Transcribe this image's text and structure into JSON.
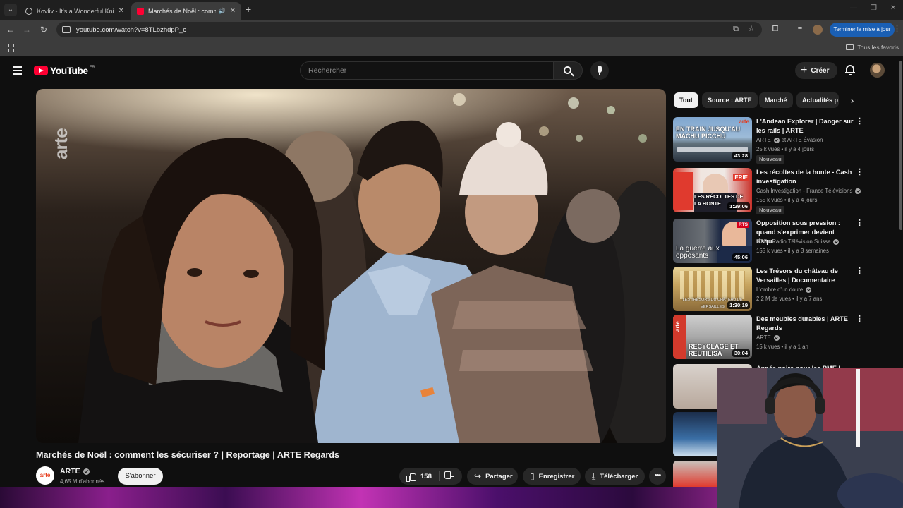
{
  "browser": {
    "tabs": [
      {
        "title": "Kovliv - It's a Wonderful Knife (",
        "active": false
      },
      {
        "title": "Marchés de Noël : commen",
        "active": true
      }
    ],
    "url": "youtube.com/watch?v=8TLbzhdpP_c",
    "update_label": "Terminer la mise à jour",
    "bookmarks_label": "Tous les favoris"
  },
  "youtube": {
    "logo_text": "YouTube",
    "country": "FR",
    "search_placeholder": "Rechercher",
    "create_label": "Créer"
  },
  "video": {
    "watermark": "arte",
    "title": "Marchés de Noël : comment les sécuriser ? | Reportage | ARTE Regards",
    "channel": "ARTE",
    "channel_avatar_text": "arte",
    "subscribers": "4,65 M d'abonnés",
    "subscribe_label": "S'abonner",
    "likes": "158",
    "share_label": "Partager",
    "save_label": "Enregistrer",
    "download_label": "Télécharger"
  },
  "chips": [
    "Tout",
    "Source : ARTE",
    "Marché",
    "Actualités p"
  ],
  "recommendations": [
    {
      "title": "L'Andean Explorer | Danger sur les rails | ARTE",
      "channel": "ARTE",
      "channel_suffix": "et ARTE Évasion",
      "meta": "25 k vues • il y a 4 jours",
      "badge": "Nouveau",
      "duration": "43:28",
      "thumb_caption": "EN TRAIN JUSQU'AU MACHU PICCHU",
      "thumb_logo": "arte"
    },
    {
      "title": "Les récoltes de la honte - Cash investigation",
      "channel": "Cash Investigation - France Télévisions",
      "channel_suffix": "",
      "meta": "155 k vues • il y a 4 jours",
      "badge": "Nouveau",
      "duration": "1:29:06",
      "thumb_caption": "LES RÉCOLTES DE LA HONTE",
      "thumb_logo": "ERIE"
    },
    {
      "title": "Opposition sous pression : quand s'exprimer devient risqu...",
      "channel": "RTS - Radio Télévision Suisse",
      "channel_suffix": "",
      "meta": "155 k vues • il y a 3 semaines",
      "badge": "",
      "duration": "45:06",
      "thumb_caption": "La guerre aux opposants",
      "thumb_logo": "RTS"
    },
    {
      "title": "Les Trésors du château de Versailles | Documentaire",
      "channel": "L'ombre d'un doute",
      "channel_suffix": "",
      "meta": "2,2 M de vues • il y a 7 ans",
      "badge": "",
      "duration": "1:30:19",
      "thumb_caption": "LES TRÉSORS DU CHÂTEAU DE VERSAILLES",
      "thumb_logo": ""
    },
    {
      "title": "Des meubles durables | ARTE Regards",
      "channel": "ARTE",
      "channel_suffix": "",
      "meta": "15 k vues • il y a 1 an",
      "badge": "",
      "duration": "30:04",
      "thumb_caption": "RECYCLAGE ET REUTILISA",
      "thumb_logo": "arte"
    },
    {
      "title": "Année noire pour les PME |",
      "channel": "",
      "channel_suffix": "",
      "meta": "",
      "badge": "",
      "duration": "",
      "thumb_caption": "",
      "thumb_logo": ""
    }
  ],
  "colors": {
    "youtube_red": "#ff0033",
    "page_bg": "#0f0f0f",
    "arte_orange": "#e63b1b",
    "update_blue": "#1a5fb4"
  }
}
